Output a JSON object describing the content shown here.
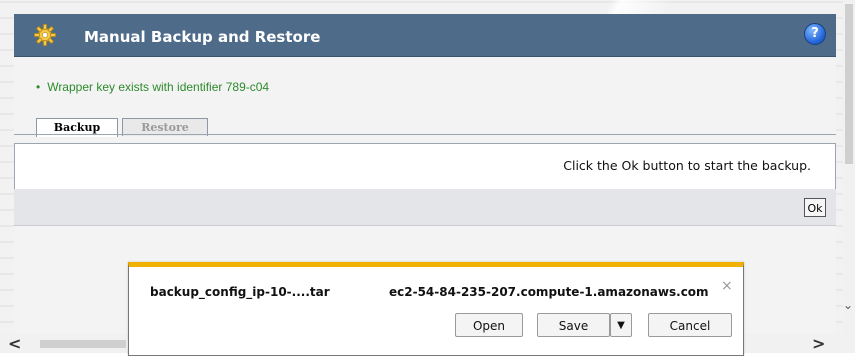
{
  "header": {
    "title": "Manual Backup and Restore",
    "help_icon_glyph": "?",
    "gear_icon": "gear-icon",
    "bar_color": "#4f6b8a"
  },
  "status": {
    "bullet": "•",
    "message": "Wrapper key exists with identifier 789-c04",
    "color": "#2d8b2d"
  },
  "tabs": [
    {
      "label": "Backup",
      "active": true
    },
    {
      "label": "Restore",
      "active": false
    }
  ],
  "backup_panel": {
    "instruction": "Click the Ok button to start the backup.",
    "ok_label": "Ok"
  },
  "download_bar": {
    "filename": "backup_config_ip-10-....tar",
    "host": "ec2-54-84-235-207.compute-1.amazonaws.com",
    "close_glyph": "×",
    "open_label": "Open",
    "save_label": "Save",
    "save_dropdown_glyph": "▼",
    "cancel_label": "Cancel",
    "accent_color": "#f0b100"
  },
  "scroll": {
    "left_glyph": "<",
    "right_glyph": ">",
    "vertical_chevron": "⌄"
  }
}
